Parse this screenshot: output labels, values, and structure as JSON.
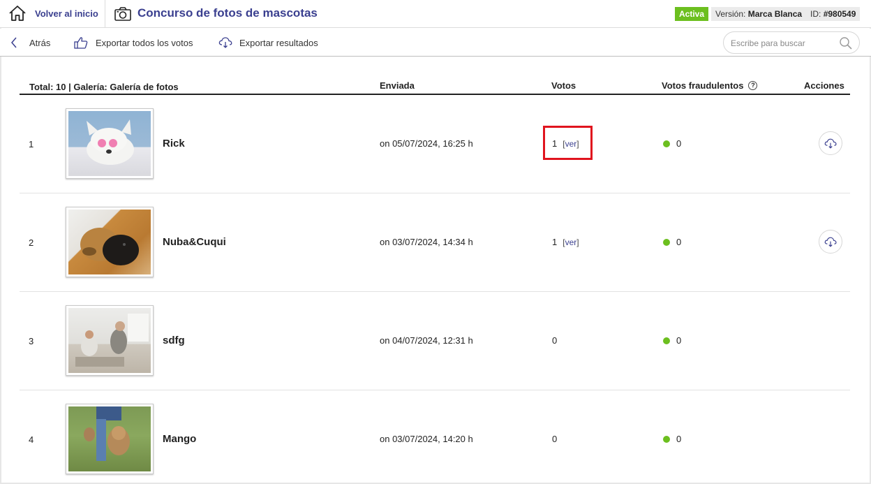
{
  "header": {
    "home_label": "Volver al inicio",
    "title": "Concurso de fotos de mascotas",
    "status_badge": "Activa",
    "version_prefix": "Versión:",
    "version_value": "Marca Blanca",
    "id_prefix": "ID:",
    "id_value": "#980549"
  },
  "toolbar": {
    "back_label": "Atrás",
    "export_votes_label": "Exportar todos los votos",
    "export_results_label": "Exportar resultados",
    "search_placeholder": "Escribe para buscar"
  },
  "table": {
    "summary": "Total: 10 | Galería: Galería de fotos",
    "col_submitted": "Enviada",
    "col_votes": "Votos",
    "col_fraud_votes": "Votos fraudulentos",
    "col_actions": "Acciones",
    "help_icon": "?",
    "rows": [
      {
        "index": "1",
        "name": "Rick",
        "submitted": "on 05/07/2024, 16:25 h",
        "votes": "1",
        "ver_label": "ver",
        "fraud_votes": "0",
        "has_download": true
      },
      {
        "index": "2",
        "name": "Nuba&Cuqui",
        "submitted": "on 03/07/2024, 14:34 h",
        "votes": "1",
        "ver_label": "ver",
        "fraud_votes": "0",
        "has_download": true
      },
      {
        "index": "3",
        "name": "sdfg",
        "submitted": "on 04/07/2024, 12:31 h",
        "votes": "0",
        "fraud_votes": "0",
        "has_download": false
      },
      {
        "index": "4",
        "name": "Mango",
        "submitted": "on 03/07/2024, 14:20 h",
        "votes": "0",
        "fraud_votes": "0",
        "has_download": false
      }
    ]
  },
  "colors": {
    "accent": "#3a3f8f",
    "active_green": "#6cbf1f",
    "highlight_red": "#e0141e"
  }
}
